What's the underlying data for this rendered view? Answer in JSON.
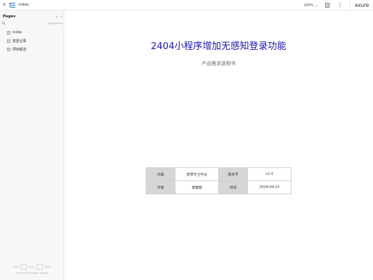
{
  "topbar": {
    "close_icon": "close-icon",
    "sitemap_icon": "sitemap-icon",
    "title": "index",
    "zoom": "100%",
    "logo": "axure"
  },
  "sidebar": {
    "title": "Pages",
    "expand_all": "Expand All",
    "items": [
      {
        "label": "index",
        "icon": "page-icon"
      },
      {
        "label": "变更记录",
        "icon": "page-icon"
      },
      {
        "label": "项目概述",
        "icon": "page-icon"
      }
    ],
    "hint_use": "Use",
    "hint_and": "and",
    "hint_keys": "keys",
    "hint_line2": "to move between pages"
  },
  "main": {
    "title": "2404小程序增加无感知登录功能",
    "subtitle": "产品需求说明书",
    "meta_table": [
      [
        {
          "label": "归属",
          "value": "智慧环卫平台"
        },
        {
          "label": "版本号",
          "value": "v1.0"
        }
      ],
      [
        {
          "label": "作者",
          "value": "唐耀斌"
        },
        {
          "label": "时间",
          "value": "2024-04-23"
        }
      ]
    ]
  },
  "colors": {
    "title": "#1a1aa6",
    "label_cell_bg": "#d6d6d6",
    "sidebar_bg": "#f7f7f7"
  }
}
